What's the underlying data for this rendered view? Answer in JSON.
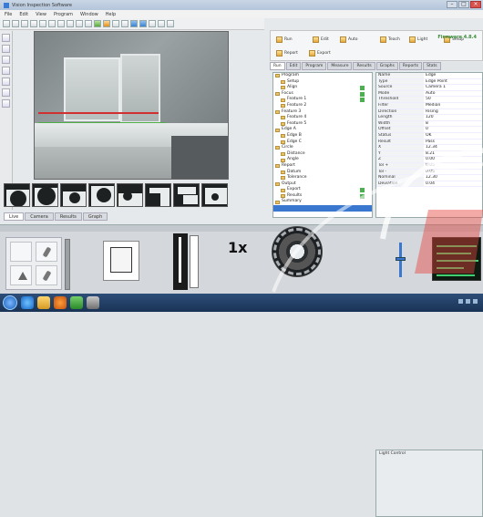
{
  "window": {
    "title": "Vision Inspection Software"
  },
  "menubar": {
    "items": [
      "File",
      "Edit",
      "View",
      "Program",
      "Window",
      "Help"
    ]
  },
  "toolbar": {
    "icons": [
      "open-icon",
      "save-icon",
      "undo-icon",
      "redo-icon",
      "zoom-icon",
      "camera-icon",
      "light-icon",
      "measure-icon",
      "run-icon",
      "stop-icon"
    ]
  },
  "right_toolbar": {
    "buttons": [
      "Run",
      "Edit",
      "Auto",
      "Teach",
      "Light",
      "Setup",
      "Report",
      "Export"
    ],
    "brand": "Firmware 4.8.4"
  },
  "right_tabs": [
    "Run",
    "Edit",
    "Program",
    "Measure",
    "Results",
    "Graphs",
    "Reports",
    "Stats"
  ],
  "tree": {
    "rows": [
      {
        "label": "Program",
        "checked": false
      },
      {
        "label": "Setup",
        "checked": false
      },
      {
        "label": "Align",
        "checked": true
      },
      {
        "label": "Focus",
        "checked": true
      },
      {
        "label": "Feature 1",
        "checked": true
      },
      {
        "label": "Feature 2",
        "checked": false
      },
      {
        "label": "Feature 3",
        "checked": false
      },
      {
        "label": "Feature 4",
        "checked": false
      },
      {
        "label": "Feature 5",
        "checked": false
      },
      {
        "label": "Edge A",
        "checked": false
      },
      {
        "label": "Edge B",
        "checked": false
      },
      {
        "label": "Edge C",
        "checked": false
      },
      {
        "label": "Circle",
        "checked": false
      },
      {
        "label": "Distance",
        "checked": false
      },
      {
        "label": "Angle",
        "checked": false
      },
      {
        "label": "Report",
        "checked": false
      },
      {
        "label": "Datum",
        "checked": false
      },
      {
        "label": "Tolerance",
        "checked": false
      },
      {
        "label": "Output",
        "checked": false
      },
      {
        "label": "Export",
        "checked": true
      },
      {
        "label": "Results",
        "checked": true
      },
      {
        "label": "Summary",
        "checked": false
      }
    ],
    "selected_index": 22
  },
  "properties": {
    "rows": [
      {
        "k": "Name",
        "v": "Edge"
      },
      {
        "k": "Type",
        "v": "Edge Point"
      },
      {
        "k": "Source",
        "v": "Camera 1"
      },
      {
        "k": "Mode",
        "v": "Auto"
      },
      {
        "k": "Threshold",
        "v": "50"
      },
      {
        "k": "Filter",
        "v": "Median"
      },
      {
        "k": "Direction",
        "v": "Rising"
      },
      {
        "k": "Length",
        "v": "120"
      },
      {
        "k": "Width",
        "v": "8"
      },
      {
        "k": "Offset",
        "v": "0"
      },
      {
        "k": "Status",
        "v": "OK"
      },
      {
        "k": "Result",
        "v": "Pass"
      },
      {
        "k": "X",
        "v": "12.34"
      },
      {
        "k": "Y",
        "v": "8.21"
      },
      {
        "k": "Z",
        "v": "0.00"
      },
      {
        "k": "Tol +",
        "v": "0.05"
      },
      {
        "k": "Tol -",
        "v": "0.05"
      },
      {
        "k": "Nominal",
        "v": "12.30"
      },
      {
        "k": "Deviation",
        "v": "0.04"
      }
    ]
  },
  "left_tabs": [
    "Live",
    "Camera",
    "Results",
    "Graph"
  ],
  "dock": {
    "zoom_label": "1x",
    "right_panel_title": "Light Control"
  }
}
